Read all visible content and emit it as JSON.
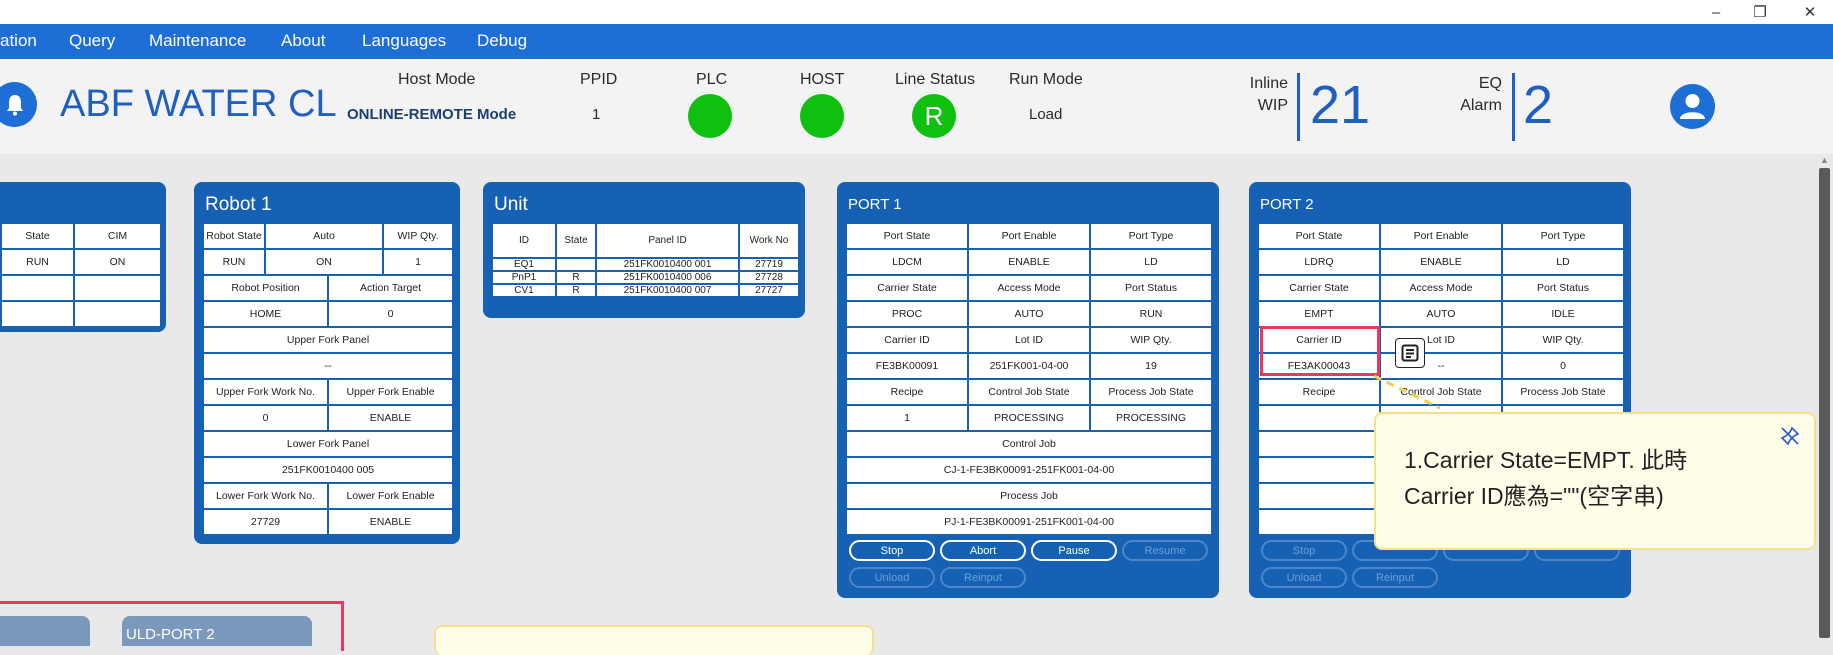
{
  "window": {
    "minimize": "–",
    "restore": "❐",
    "close": "✕"
  },
  "menu": {
    "items": [
      "ation",
      "Query",
      "Maintenance",
      "About",
      "Languages",
      "Debug"
    ]
  },
  "header": {
    "title": "ABF WATER CLEA",
    "host_mode": {
      "label": "Host Mode",
      "value": "ONLINE-REMOTE Mode"
    },
    "ppid": {
      "label": "PPID",
      "value": "1"
    },
    "plc": {
      "label": "PLC",
      "color": "#10c010"
    },
    "host": {
      "label": "HOST",
      "color": "#10c010"
    },
    "line_status": {
      "label": "Line Status",
      "value": "R"
    },
    "run_mode": {
      "label": "Run Mode",
      "value": "Load"
    },
    "inline_wip": {
      "label1": "Inline",
      "label2": "WIP",
      "value": "21"
    },
    "eq_alarm": {
      "label1": "EQ",
      "label2": "Alarm",
      "value": "2"
    }
  },
  "eq_panel": {
    "headers": [
      "State",
      "CIM"
    ],
    "row1": [
      "RUN",
      "ON"
    ]
  },
  "robot": {
    "title": "Robot 1",
    "h1": [
      "Robot State",
      "Auto",
      "WIP Qty."
    ],
    "v1": [
      "RUN",
      "ON",
      "1"
    ],
    "h2": [
      "Robot Position",
      "Action Target"
    ],
    "v2": [
      "HOME",
      "0"
    ],
    "upper_panel_label": "Upper Fork Panel",
    "upper_panel_value": "--",
    "h3": [
      "Upper Fork Work No.",
      "Upper Fork Enable"
    ],
    "v3": [
      "0",
      "ENABLE"
    ],
    "lower_panel_label": "Lower Fork Panel",
    "lower_panel_value": "251FK0010400 005",
    "h4": [
      "Lower Fork Work No.",
      "Lower Fork Enable"
    ],
    "v4": [
      "27729",
      "ENABLE"
    ]
  },
  "unit": {
    "title": "Unit",
    "headers": [
      "ID",
      "State",
      "Panel ID",
      "Work No"
    ],
    "rows": [
      [
        "EQ1",
        "",
        "251FK0010400 001",
        "27719"
      ],
      [
        "PnP1",
        "R",
        "251FK0010400 006",
        "27728"
      ],
      [
        "CV1",
        "R",
        "251FK0010400 007",
        "27727"
      ]
    ]
  },
  "port1": {
    "title": "PORT 1",
    "h1": [
      "Port State",
      "Port Enable",
      "Port Type"
    ],
    "v1": [
      "LDCM",
      "ENABLE",
      "LD"
    ],
    "h2": [
      "Carrier State",
      "Access Mode",
      "Port Status"
    ],
    "v2": [
      "PROC",
      "AUTO",
      "RUN"
    ],
    "h3": [
      "Carrier ID",
      "Lot ID",
      "WIP Qty."
    ],
    "v3": [
      "FE3BK00091",
      "251FK001-04-00",
      "19"
    ],
    "h4": [
      "Recipe",
      "Control Job State",
      "Process Job State"
    ],
    "v4": [
      "1",
      "PROCESSING",
      "PROCESSING"
    ],
    "control_job_label": "Control Job",
    "control_job_value": "CJ-1-FE3BK00091-251FK001-04-00",
    "process_job_label": "Process Job",
    "process_job_value": "PJ-1-FE3BK00091-251FK001-04-00",
    "buttons": {
      "stop": "Stop",
      "abort": "Abort",
      "pause": "Pause",
      "resume": "Resume",
      "unload": "Unload",
      "reinput": "Reinput"
    }
  },
  "port2": {
    "title": "PORT 2",
    "h1": [
      "Port State",
      "Port Enable",
      "Port Type"
    ],
    "v1": [
      "LDRQ",
      "ENABLE",
      "LD"
    ],
    "h2": [
      "Carrier State",
      "Access Mode",
      "Port Status"
    ],
    "v2": [
      "EMPT",
      "AUTO",
      "IDLE"
    ],
    "h3": [
      "Carrier ID",
      "Lot ID",
      "WIP Qty."
    ],
    "v3": [
      "FE3AK00043",
      "--",
      "0"
    ],
    "h4": [
      "Recipe",
      "Control Job State",
      "Process Job State"
    ],
    "buttons": {
      "stop": "Stop",
      "unload": "Unload",
      "reinput": "Reinput"
    }
  },
  "note": {
    "line1": "1.Carrier State=EMPT. 此時",
    "line2": "Carrier ID應為=\"\"(空字串)",
    "icon": "note-icon",
    "pin": "unpin-icon"
  },
  "bottom": {
    "uld_port2": "ULD-PORT 2"
  }
}
